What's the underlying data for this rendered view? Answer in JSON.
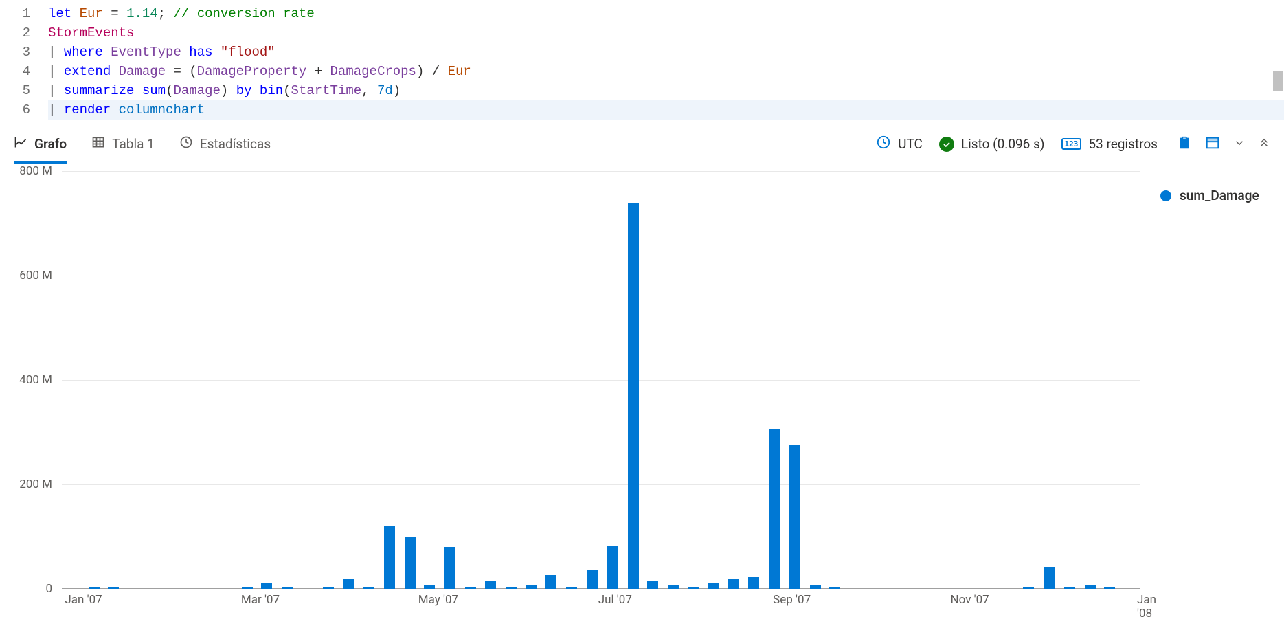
{
  "editor": {
    "line_numbers": [
      "1",
      "2",
      "3",
      "4",
      "5",
      "6"
    ],
    "tokens": [
      [
        [
          "let",
          "tok-kw"
        ],
        [
          " ",
          ""
        ],
        [
          "Eur",
          "tok-var"
        ],
        [
          " = ",
          ""
        ],
        [
          "1.14",
          "tok-num"
        ],
        [
          ";",
          ""
        ],
        [
          " ",
          ""
        ],
        [
          "// conversion rate",
          "tok-com"
        ]
      ],
      [
        [
          "StormEvents",
          "tok-tbl"
        ]
      ],
      [
        [
          "| ",
          "tok-punct"
        ],
        [
          "where",
          "tok-kw"
        ],
        [
          " ",
          ""
        ],
        [
          "EventType",
          "tok-col"
        ],
        [
          " ",
          ""
        ],
        [
          "has",
          "tok-kw"
        ],
        [
          " ",
          ""
        ],
        [
          "\"flood\"",
          "tok-str"
        ]
      ],
      [
        [
          "| ",
          "tok-punct"
        ],
        [
          "extend",
          "tok-kw"
        ],
        [
          " ",
          ""
        ],
        [
          "Damage",
          "tok-col"
        ],
        [
          " = (",
          ""
        ],
        [
          "DamageProperty",
          "tok-col"
        ],
        [
          " + ",
          ""
        ],
        [
          "DamageCrops",
          "tok-col"
        ],
        [
          ") / ",
          ""
        ],
        [
          "Eur",
          "tok-var"
        ]
      ],
      [
        [
          "| ",
          "tok-punct"
        ],
        [
          "summarize",
          "tok-kw"
        ],
        [
          " ",
          ""
        ],
        [
          "sum",
          "tok-fn"
        ],
        [
          "(",
          ""
        ],
        [
          "Damage",
          "tok-col"
        ],
        [
          ") ",
          ""
        ],
        [
          "by",
          "tok-kw"
        ],
        [
          " ",
          ""
        ],
        [
          "bin",
          "tok-fn"
        ],
        [
          "(",
          ""
        ],
        [
          "StartTime",
          "tok-col"
        ],
        [
          ", ",
          ""
        ],
        [
          "7d",
          "tok-type"
        ],
        [
          ")",
          ""
        ]
      ],
      [
        [
          "| ",
          "tok-punct"
        ],
        [
          "render",
          "tok-kw"
        ],
        [
          " ",
          ""
        ],
        [
          "columnchart",
          "tok-type"
        ]
      ]
    ]
  },
  "tabs": {
    "graph": "Grafo",
    "table": "Tabla 1",
    "stats": "Estadísticas"
  },
  "status": {
    "tz": "UTC",
    "ready": "Listo (0.096 s)",
    "records": "53 registros"
  },
  "chart_data": {
    "type": "bar",
    "title": "",
    "xlabel": "",
    "ylabel": "",
    "ylim": [
      0,
      800
    ],
    "y_ticks": [
      "0",
      "200 M",
      "400 M",
      "600 M",
      "800 M"
    ],
    "x_ticks": [
      "Jan '07",
      "Mar '07",
      "May '07",
      "Jul '07",
      "Sep '07",
      "Nov '07",
      "Jan '08"
    ],
    "x_tick_positions_pct": [
      2,
      18.3,
      34.7,
      51,
      67.3,
      83.7,
      100
    ],
    "series": [
      {
        "name": "sum_Damage",
        "color": "#0078d4",
        "points": [
          {
            "x_pct": 3.0,
            "value": 3
          },
          {
            "x_pct": 4.8,
            "value": 2
          },
          {
            "x_pct": 17.2,
            "value": 2
          },
          {
            "x_pct": 19.0,
            "value": 10
          },
          {
            "x_pct": 20.9,
            "value": 3
          },
          {
            "x_pct": 24.7,
            "value": 2
          },
          {
            "x_pct": 26.6,
            "value": 18
          },
          {
            "x_pct": 28.5,
            "value": 4
          },
          {
            "x_pct": 30.4,
            "value": 120
          },
          {
            "x_pct": 32.3,
            "value": 100
          },
          {
            "x_pct": 34.1,
            "value": 6
          },
          {
            "x_pct": 36.0,
            "value": 80
          },
          {
            "x_pct": 37.9,
            "value": 4
          },
          {
            "x_pct": 39.8,
            "value": 16
          },
          {
            "x_pct": 41.7,
            "value": 2
          },
          {
            "x_pct": 43.5,
            "value": 6
          },
          {
            "x_pct": 45.4,
            "value": 26
          },
          {
            "x_pct": 47.3,
            "value": 3
          },
          {
            "x_pct": 49.2,
            "value": 35
          },
          {
            "x_pct": 51.1,
            "value": 82
          },
          {
            "x_pct": 53.0,
            "value": 740
          },
          {
            "x_pct": 54.8,
            "value": 14
          },
          {
            "x_pct": 56.7,
            "value": 8
          },
          {
            "x_pct": 58.6,
            "value": 3
          },
          {
            "x_pct": 60.5,
            "value": 10
          },
          {
            "x_pct": 62.3,
            "value": 20
          },
          {
            "x_pct": 64.2,
            "value": 22
          },
          {
            "x_pct": 66.1,
            "value": 305
          },
          {
            "x_pct": 68.0,
            "value": 275
          },
          {
            "x_pct": 69.9,
            "value": 8
          },
          {
            "x_pct": 71.7,
            "value": 2
          },
          {
            "x_pct": 89.7,
            "value": 2
          },
          {
            "x_pct": 91.6,
            "value": 42
          },
          {
            "x_pct": 93.5,
            "value": 3
          },
          {
            "x_pct": 95.4,
            "value": 6
          },
          {
            "x_pct": 97.2,
            "value": 2
          }
        ]
      }
    ]
  },
  "legend_label": "sum_Damage"
}
